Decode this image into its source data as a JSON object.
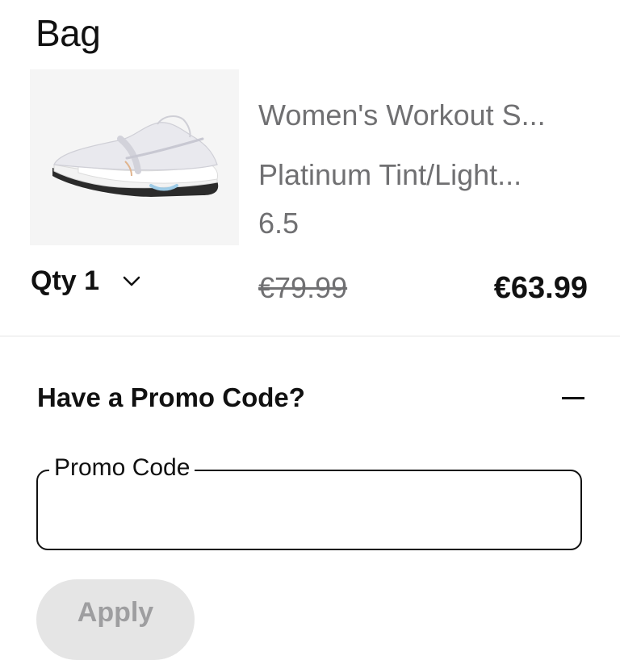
{
  "page": {
    "title": "Bag"
  },
  "item": {
    "name": "Women's Workout S...",
    "color": "Platinum Tint/Light...",
    "size": "6.5",
    "qty_label": "Qty 1",
    "original_price": "€79.99",
    "sale_price": "€63.99",
    "image_icon": "sneaker-image"
  },
  "promo": {
    "heading": "Have a Promo Code?",
    "field_label": "Promo Code",
    "field_value": "",
    "field_placeholder": "",
    "apply_label": "Apply"
  },
  "colors": {
    "text_primary": "#111111",
    "text_secondary": "#707072",
    "thumb_bg": "#f5f5f5",
    "divider": "#e5e5e5",
    "disabled_button_bg": "#e5e5e5",
    "disabled_button_text": "#9e9ea0"
  }
}
